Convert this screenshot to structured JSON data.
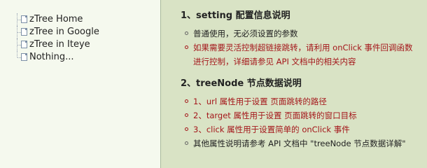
{
  "tree": {
    "items": [
      {
        "label": "zTree Home"
      },
      {
        "label": "zTree in Google"
      },
      {
        "label": "zTree in Iteye"
      },
      {
        "label": "Nothing..."
      }
    ]
  },
  "doc": {
    "section1": {
      "title": "1、setting 配置信息说明",
      "bullets": [
        {
          "text": "普通使用，无必须设置的参数"
        },
        {
          "text": "如果需要灵活控制超链接跳转，请利用 onClick 事件回调函数",
          "cont": "进行控制，详细请参见 API 文档中的相关内容"
        }
      ]
    },
    "section2": {
      "title": "2、treeNode 节点数据说明",
      "bullets": [
        {
          "text": "1、url 属性用于设置 页面跳转的路径"
        },
        {
          "text": "2、target 属性用于设置 页面跳转的窗口目标"
        },
        {
          "text": "3、click 属性用于设置简单的 onClick 事件"
        },
        {
          "text": "其他属性说明请参考 API 文档中 \"treeNode 节点数据详解\""
        }
      ]
    }
  },
  "colors": {
    "background": "#d9e3c5",
    "tree_panel": "#f5f9ee",
    "highlight_text": "#a4161a",
    "normal_text": "#222222"
  }
}
